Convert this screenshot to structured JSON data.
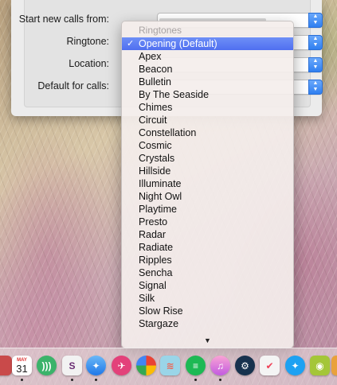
{
  "preferences": {
    "rows": [
      {
        "label": "Start new calls from:"
      },
      {
        "label": "Ringtone:"
      },
      {
        "label": "Location:"
      },
      {
        "label": "Default for calls:"
      }
    ]
  },
  "ringtone_menu": {
    "header": "Ringtones",
    "selected_check": "✓",
    "items": [
      "Opening (Default)",
      "Apex",
      "Beacon",
      "Bulletin",
      "By The Seaside",
      "Chimes",
      "Circuit",
      "Constellation",
      "Cosmic",
      "Crystals",
      "Hillside",
      "Illuminate",
      "Night Owl",
      "Playtime",
      "Presto",
      "Radar",
      "Radiate",
      "Ripples",
      "Sencha",
      "Signal",
      "Silk",
      "Slow Rise",
      "Stargaze"
    ],
    "selected_index": 0,
    "scroll_indicator": "▼"
  },
  "dock": {
    "calendar_month": "MAY",
    "calendar_day": "31",
    "icons": [
      "partial-app-icon",
      "calendar-icon",
      "wireless-icon",
      "slack-icon",
      "safari-icon",
      "kodi-icon",
      "picasa-icon",
      "fish-app-icon",
      "spotify-icon",
      "itunes-icon",
      "steam-icon",
      "pocket-icon",
      "twitter-icon",
      "android-icon",
      "partial-app-icon-right"
    ]
  },
  "colors": {
    "selection": "#5b7cf3",
    "popup_accent": "#3b86f5"
  }
}
